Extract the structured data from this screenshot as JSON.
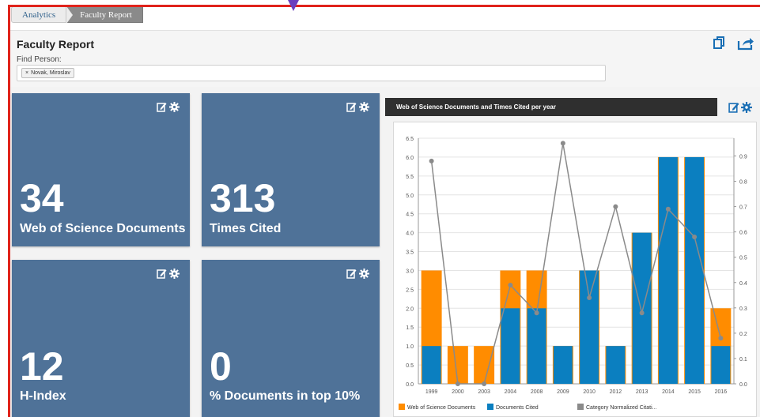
{
  "breadcrumb": {
    "items": [
      "Analytics",
      "Faculty Report"
    ]
  },
  "header": {
    "title": "Faculty Report",
    "find_label": "Find Person:",
    "selected_person": "Novak, Miroslav",
    "chip_remove": "×"
  },
  "tiles": [
    {
      "value": "34",
      "label": "Web of Science Documents"
    },
    {
      "value": "313",
      "label": "Times Cited"
    },
    {
      "value": "12",
      "label": "H-Index"
    },
    {
      "value": "0",
      "label": "% Documents in top 10%"
    }
  ],
  "colors": {
    "tile_bg": "#4f7298",
    "bar_orange": "#ff8c00",
    "bar_blue": "#0b7fc0",
    "line_gray": "#8a8a8a",
    "frame_red": "#e0231b",
    "title_bar": "#2f2f2f"
  },
  "icons": [
    "copy-icon",
    "share-icon",
    "edit-icon",
    "gear-icon"
  ],
  "chart_title": "Web of Science Documents and Times Cited per year",
  "chart_data": {
    "type": "bar",
    "categories": [
      "1999",
      "2000",
      "2003",
      "2004",
      "2008",
      "2009",
      "2010",
      "2012",
      "2013",
      "2014",
      "2015",
      "2016"
    ],
    "series": [
      {
        "name": "Web of Science Documents",
        "type": "bar",
        "axis": "left",
        "values": [
          3,
          1,
          1,
          3,
          3,
          1,
          3,
          1,
          4,
          6,
          6,
          2
        ]
      },
      {
        "name": "Documents Cited",
        "type": "bar",
        "axis": "left",
        "values": [
          1,
          0,
          0,
          2,
          2,
          1,
          3,
          1,
          4,
          6,
          6,
          1
        ]
      },
      {
        "name": "Category Normalized Citati...",
        "type": "line",
        "axis": "right",
        "values": [
          0.88,
          0.0,
          0.0,
          0.39,
          0.28,
          0.95,
          0.34,
          0.7,
          0.28,
          0.69,
          0.58,
          0.18
        ]
      }
    ],
    "y_left": {
      "ylim": [
        0,
        6.5
      ],
      "ticks": [
        "0.0",
        "0.5",
        "1.0",
        "1.5",
        "2.0",
        "2.5",
        "3.0",
        "3.5",
        "4.0",
        "4.5",
        "5.0",
        "5.5",
        "6.0",
        "6.5"
      ]
    },
    "y_right": {
      "ylim": [
        0,
        0.97
      ],
      "ticks": [
        "0.0",
        "0.1",
        "0.2",
        "0.3",
        "0.4",
        "0.5",
        "0.6",
        "0.7",
        "0.8",
        "0.9"
      ]
    },
    "grid": true,
    "legend": "bottom"
  }
}
